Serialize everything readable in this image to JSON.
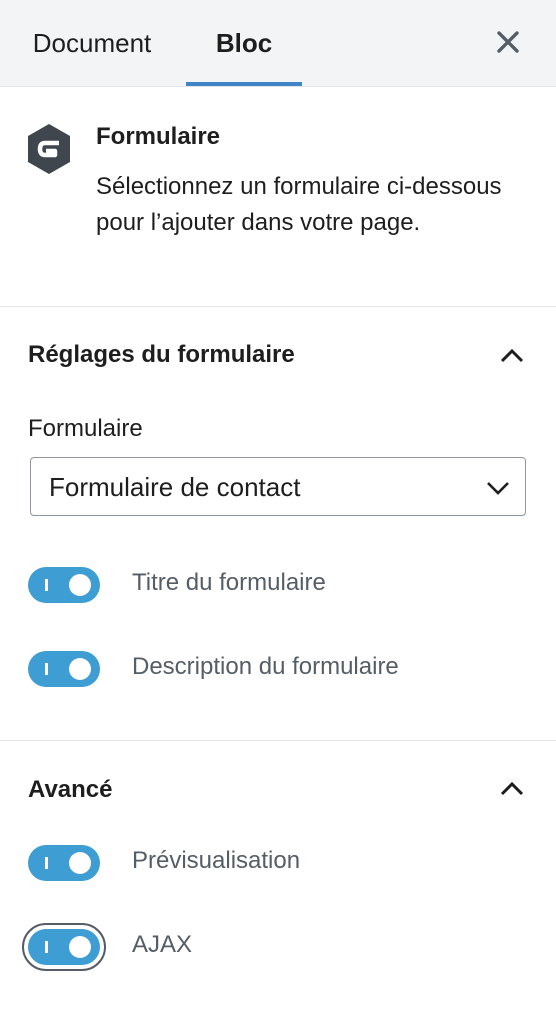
{
  "tabs": {
    "document_label": "Document",
    "bloc_label": "Bloc",
    "active": "Bloc"
  },
  "block_card": {
    "title": "Formulaire",
    "description": "Sélectionnez un formulaire ci-dessous pour l’ajouter dans votre page.",
    "icon": "gravity-forms-icon"
  },
  "form_settings": {
    "title": "Réglages du formulaire",
    "expanded": true,
    "select_label": "Formulaire",
    "select_value": "Formulaire de contact",
    "toggles": [
      {
        "label": "Titre du formulaire",
        "checked": true
      },
      {
        "label": "Description du formulaire",
        "checked": true
      }
    ]
  },
  "advanced": {
    "title": "Avancé",
    "expanded": true,
    "toggles": [
      {
        "label": "Prévisualisation",
        "checked": true
      },
      {
        "label": "AJAX",
        "checked": true,
        "focused": true
      }
    ]
  },
  "colors": {
    "accent": "#3e84c6",
    "toggle_on": "#3e9dd3",
    "tabbar_bg": "#f3f4f5",
    "border": "#e2e4e7"
  }
}
